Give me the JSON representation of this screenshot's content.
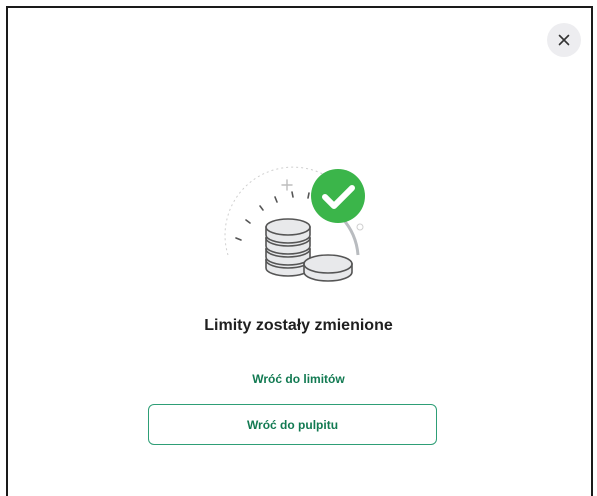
{
  "dialog": {
    "title": "Limity zostały zmienione",
    "close_icon": "close-icon",
    "illustration_icon": "coins-success-icon",
    "success_color": "#3bb54a",
    "accent_color": "#127a52"
  },
  "actions": {
    "back_to_limits_label": "Wróć do limitów",
    "back_to_dashboard_label": "Wróć do pulpitu"
  }
}
